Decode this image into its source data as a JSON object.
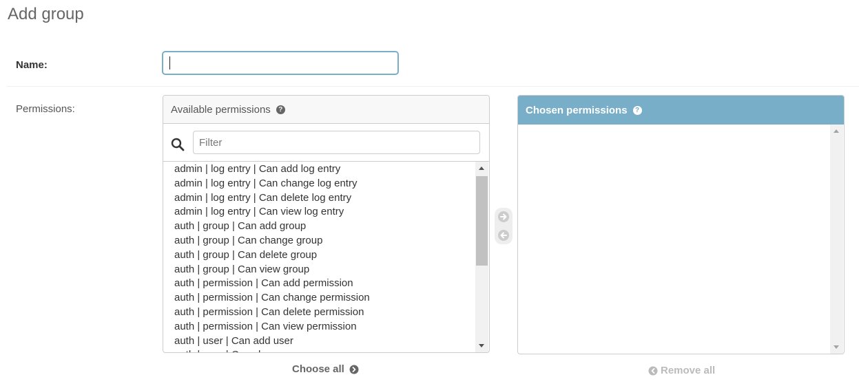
{
  "page": {
    "title": "Add group"
  },
  "form": {
    "name_label": "Name:",
    "name_value": "",
    "permissions_label": "Permissions:"
  },
  "available": {
    "title": "Available permissions",
    "help_glyph": "?",
    "filter_placeholder": "Filter",
    "options": [
      "admin | log entry | Can add log entry",
      "admin | log entry | Can change log entry",
      "admin | log entry | Can delete log entry",
      "admin | log entry | Can view log entry",
      "auth | group | Can add group",
      "auth | group | Can change group",
      "auth | group | Can delete group",
      "auth | group | Can view group",
      "auth | permission | Can add permission",
      "auth | permission | Can change permission",
      "auth | permission | Can delete permission",
      "auth | permission | Can view permission",
      "auth | user | Can add user",
      "auth | user | Can change user"
    ],
    "choose_all_label": "Choose all"
  },
  "chosen": {
    "title": "Chosen permissions",
    "help_glyph": "?",
    "remove_all_label": "Remove all"
  },
  "colors": {
    "accent": "#79aec8",
    "border": "#cccccc",
    "disabled_text": "#bbbbbb"
  },
  "icons": [
    "search-icon",
    "help-icon",
    "add-arrow-icon",
    "remove-arrow-icon",
    "chevron-right-circle-icon",
    "chevron-left-circle-icon"
  ]
}
